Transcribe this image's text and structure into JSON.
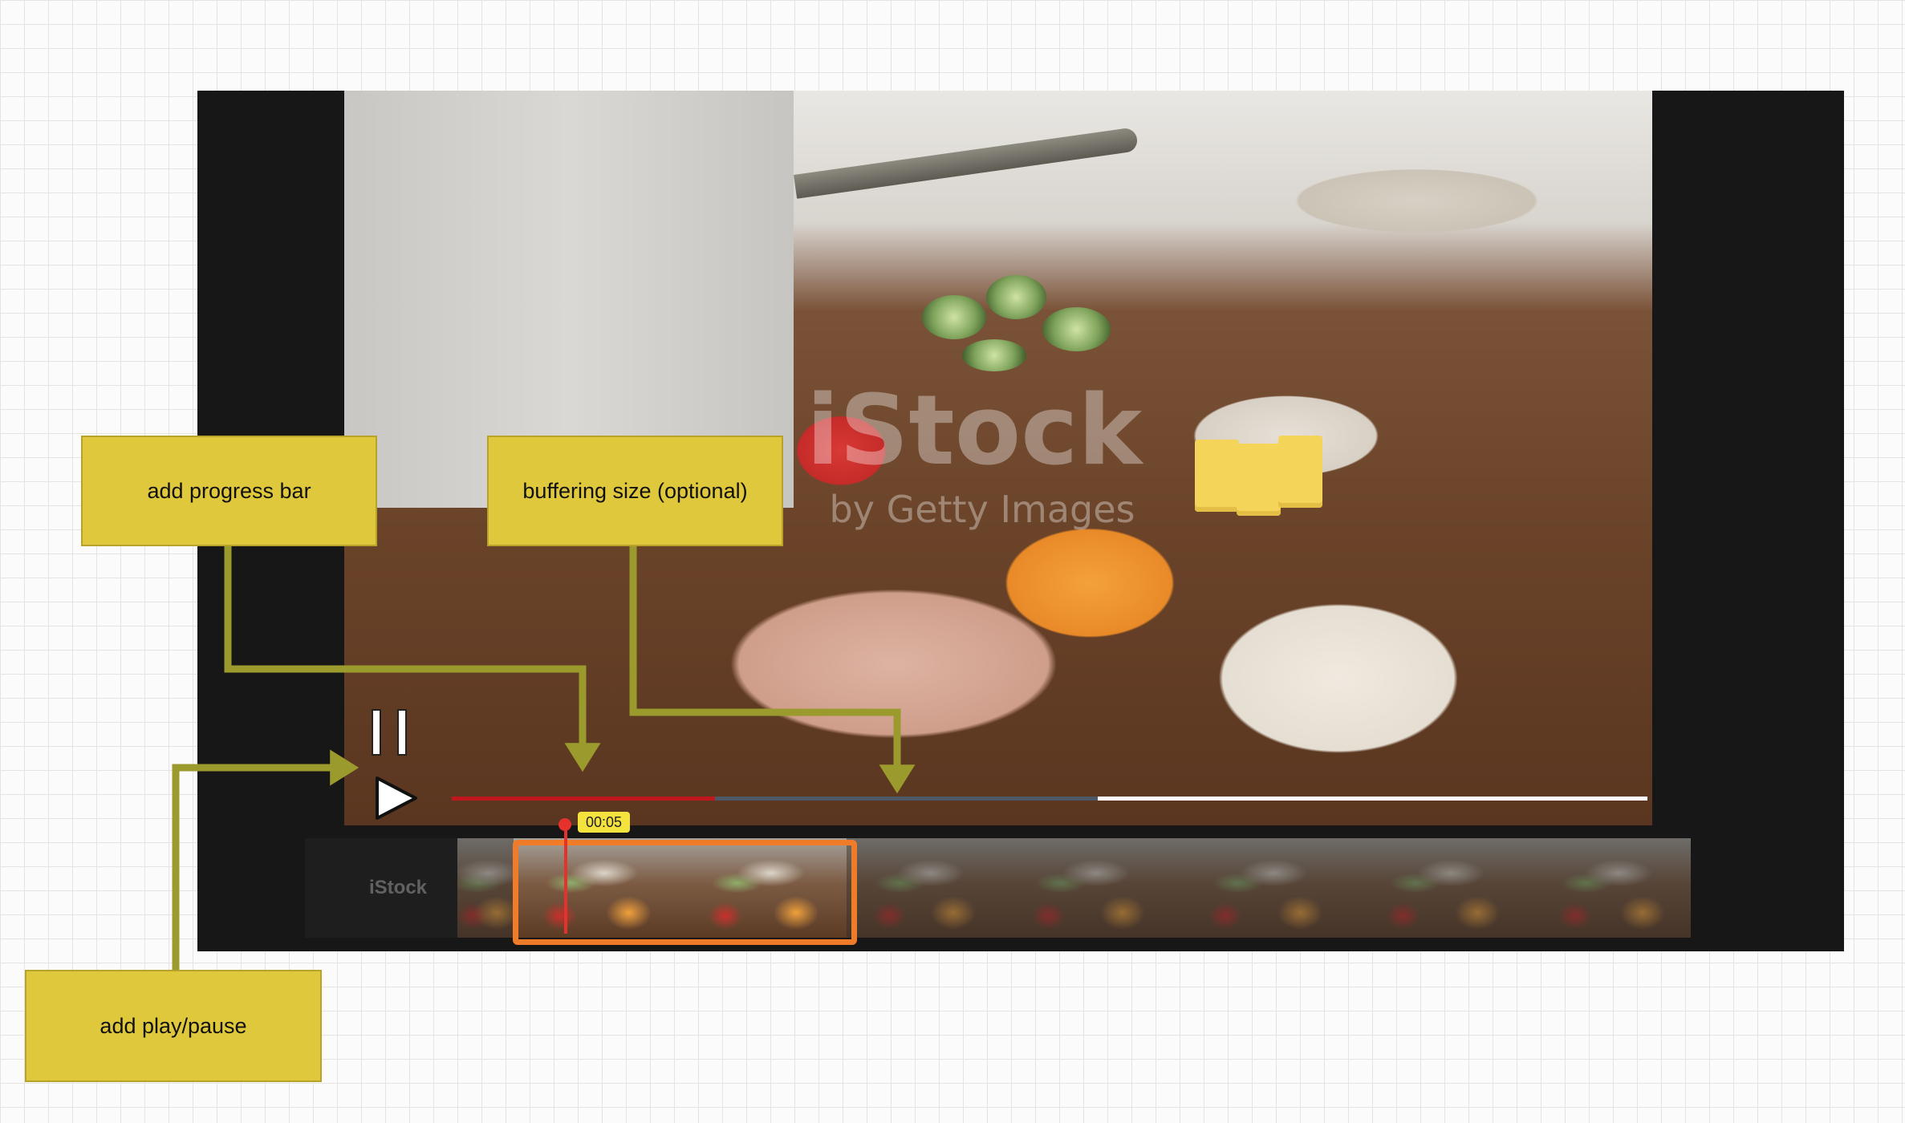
{
  "video": {
    "watermark_line1": "iStock",
    "watermark_line2": "by Getty Images"
  },
  "progress": {
    "played_fraction": 0.22,
    "buffered_fraction": 0.54
  },
  "timeline": {
    "current_time": "00:05",
    "filmstrip_watermark": "iStock"
  },
  "annotations": {
    "progress_bar": "add progress bar",
    "buffering": "buffering size (optional)",
    "play_pause": "add play/pause"
  },
  "colors": {
    "played": "#c0161e",
    "buffered": "#4c5866",
    "track": "#ffffff",
    "callout": "#dfc83c",
    "arrow": "#9b9a2c",
    "selection": "#f07c2a"
  },
  "icons": {
    "pause": "pause-icon",
    "play": "play-icon"
  }
}
